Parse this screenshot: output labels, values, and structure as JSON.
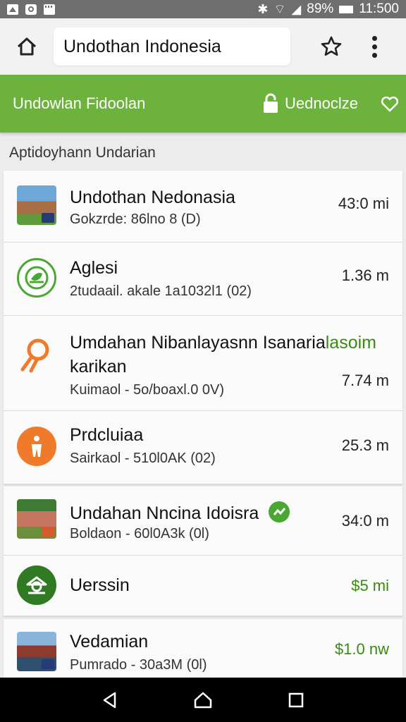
{
  "status_bar": {
    "battery_text": "89%",
    "time": "11:500"
  },
  "browser": {
    "url_text": "Undothan Indonesia"
  },
  "app_bar": {
    "title": "Undowlan Fidoolan",
    "action_label": "Uednoclze"
  },
  "section_title": "Aptidoyhann Undarian",
  "items": [
    {
      "title": "Undothan Nedonasia",
      "subtitle": "Gokzrde: 86lno 8 (D)",
      "distance": "43:0 mi",
      "icon": "mosque-photo"
    },
    {
      "title": "Aglesi",
      "subtitle": "2tudaail. akale 1a1032l1 (02)",
      "distance": "1.36 m",
      "icon": "leaf-icon"
    },
    {
      "title_line1": "Umdahan Nibanlayasnn Isanaria",
      "title_highlight": "lasoim",
      "title_line2": "karikan",
      "subtitle": "Kuimaol - 5o/boaxl.0 0V)",
      "distance": "7.74 m",
      "icon": "location-pin-icon"
    },
    {
      "title": "Prdcluiaa",
      "subtitle": "Sairkaol - 510l0AK (02)",
      "distance": "25.3 m",
      "icon": "person-icon"
    },
    {
      "title": "Undahan Nncina Idoisra",
      "subtitle": "Boldaon - 60l0A3k (0l)",
      "distance": "34:0 m",
      "icon": "person-photo"
    },
    {
      "title": "Uerssin",
      "subtitle": "",
      "distance": "$5 mi",
      "icon": "temple-icon"
    },
    {
      "title": "Vedamian",
      "subtitle": "Pumrado - 30a3M (0l)",
      "distance": "$1.0 nw",
      "icon": "building-photo"
    }
  ],
  "colors": {
    "accent_green": "#6cb23c",
    "distance_green": "#3a8a12",
    "pin_orange": "#ef7a2a",
    "leaf_green": "#48a832",
    "temple_green": "#2f7a23"
  }
}
